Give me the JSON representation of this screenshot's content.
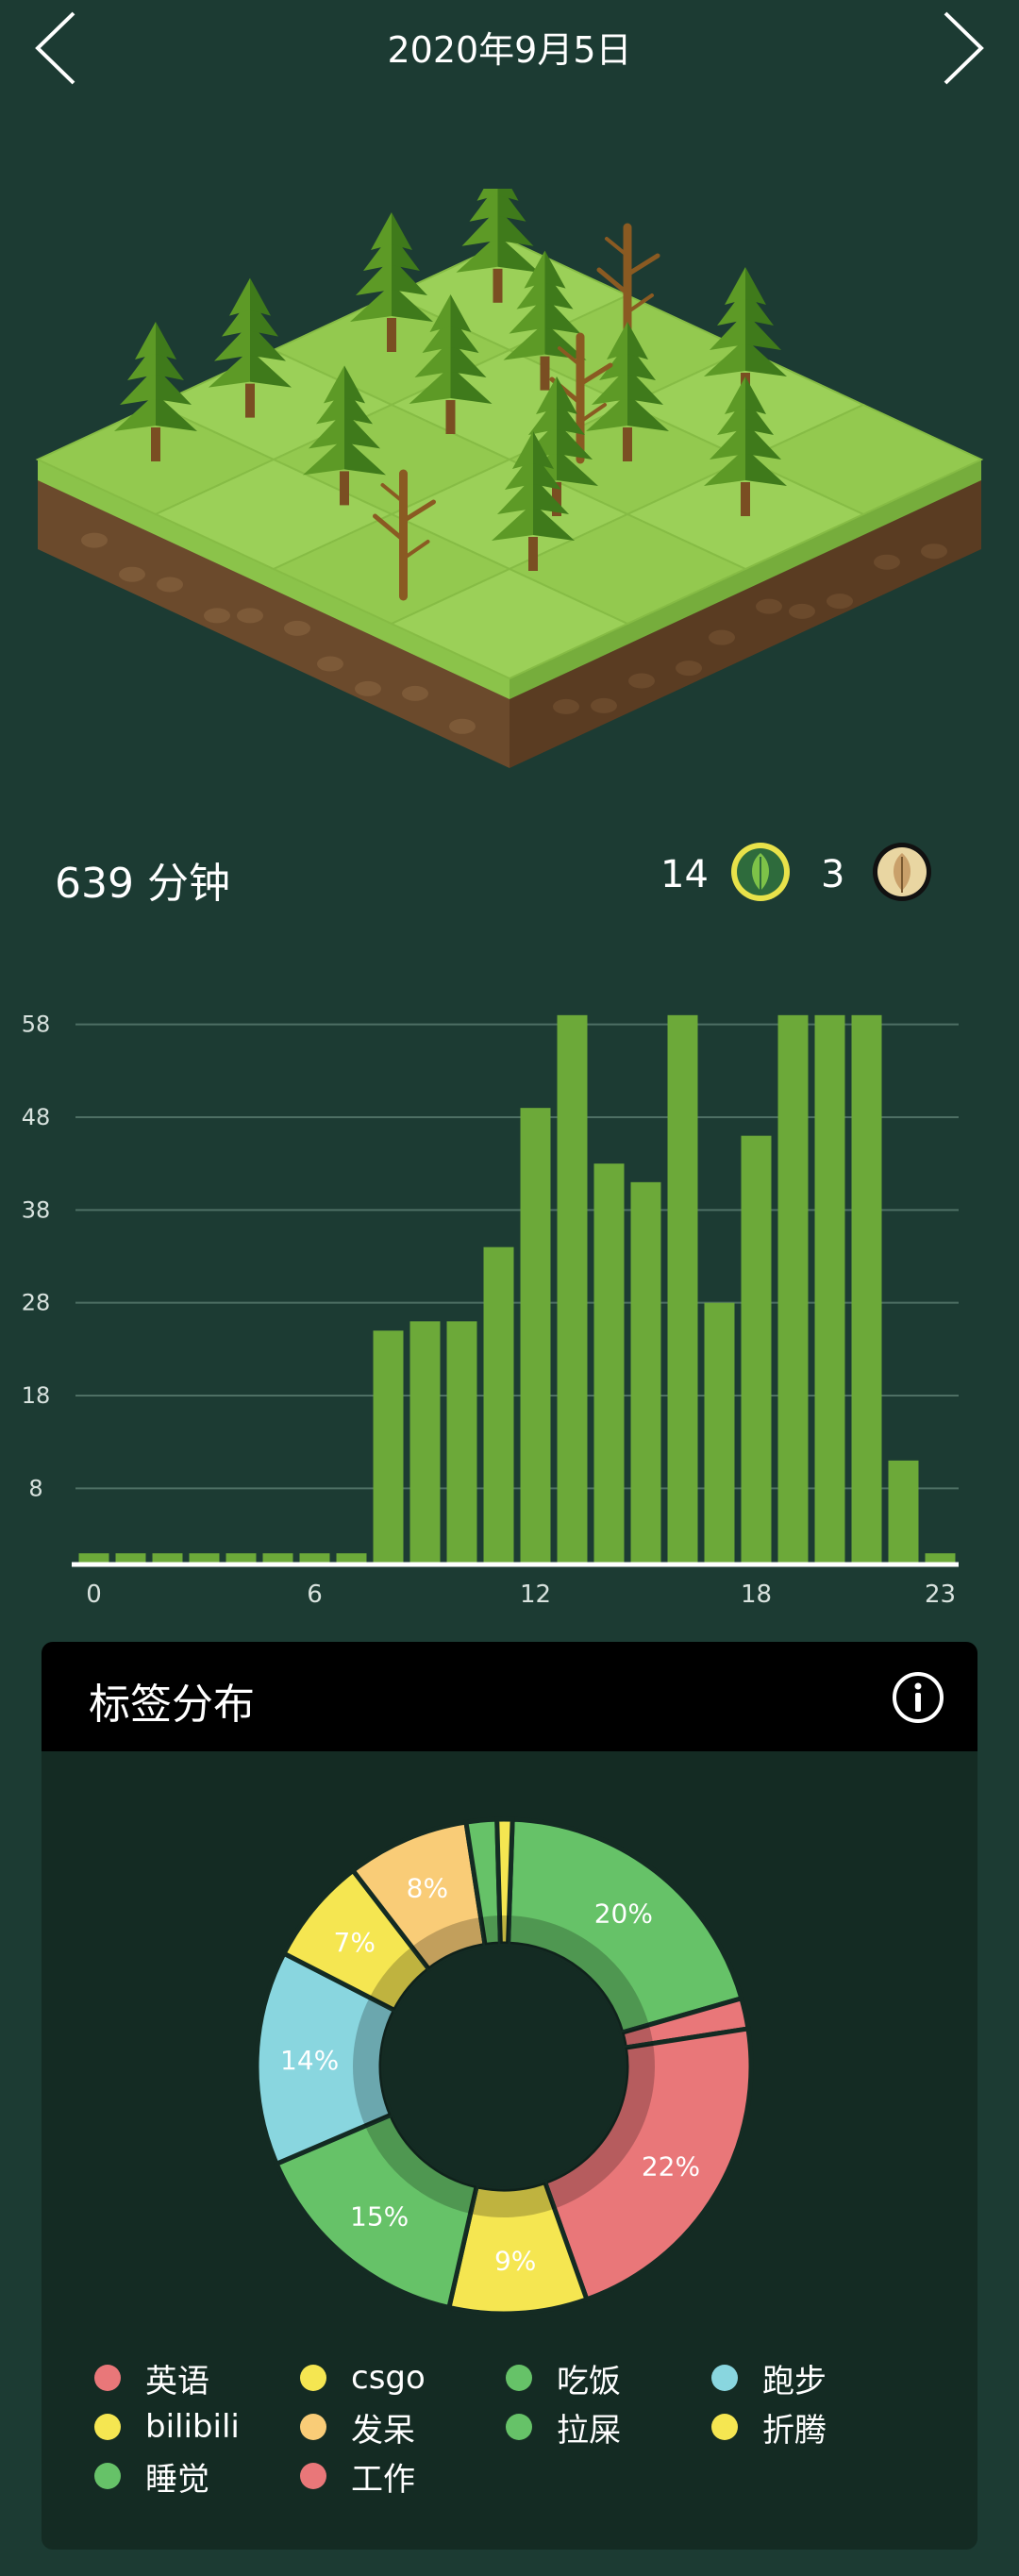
{
  "header": {
    "date": "2020年9月5日"
  },
  "summary": {
    "minutes": "639 分钟",
    "healthy_count": "14",
    "dead_count": "3"
  },
  "chart_data": [
    {
      "type": "bar",
      "x": [
        0,
        1,
        2,
        3,
        4,
        5,
        6,
        7,
        8,
        9,
        10,
        11,
        12,
        13,
        14,
        15,
        16,
        17,
        18,
        19,
        20,
        21,
        22,
        23
      ],
      "values": [
        1,
        1,
        1,
        1,
        1,
        1,
        1,
        1,
        25,
        26,
        26,
        34,
        49,
        59,
        43,
        41,
        59,
        28,
        46,
        59,
        59,
        59,
        11,
        1
      ],
      "xticks": [
        0,
        6,
        12,
        18,
        23
      ],
      "yticks": [
        8,
        18,
        28,
        38,
        48,
        58
      ],
      "ylim": [
        0,
        60
      ],
      "grid": true,
      "color": "#6ca939"
    },
    {
      "type": "pie",
      "slices": [
        {
          "label": "20%",
          "value": 20,
          "color": "#66c268"
        },
        {
          "label": "",
          "value": 2,
          "color": "#e97779"
        },
        {
          "label": "22%",
          "value": 22,
          "color": "#e97779"
        },
        {
          "label": "9%",
          "value": 9,
          "color": "#f5e651"
        },
        {
          "label": "15%",
          "value": 15,
          "color": "#66c268"
        },
        {
          "label": "14%",
          "value": 14,
          "color": "#89d6df"
        },
        {
          "label": "7%",
          "value": 7,
          "color": "#f5e651"
        },
        {
          "label": "8%",
          "value": 8,
          "color": "#f9cc77"
        },
        {
          "label": "",
          "value": 2,
          "color": "#66c268"
        },
        {
          "label": "",
          "value": 1,
          "color": "#f5e651"
        }
      ]
    }
  ],
  "tags": {
    "title": "标签分布",
    "legend": [
      {
        "label": "英语",
        "color": "#e97779"
      },
      {
        "label": "csgo",
        "color": "#f5e651"
      },
      {
        "label": "吃饭",
        "color": "#66c268"
      },
      {
        "label": "跑步",
        "color": "#89d6df"
      },
      {
        "label": "bilibili",
        "color": "#f5e651"
      },
      {
        "label": "发呆",
        "color": "#f9cc77"
      },
      {
        "label": "拉屎",
        "color": "#66c268"
      },
      {
        "label": "折腾",
        "color": "#f5e651"
      },
      {
        "label": "睡觉",
        "color": "#66c268"
      },
      {
        "label": "工作",
        "color": "#e97779"
      }
    ]
  }
}
